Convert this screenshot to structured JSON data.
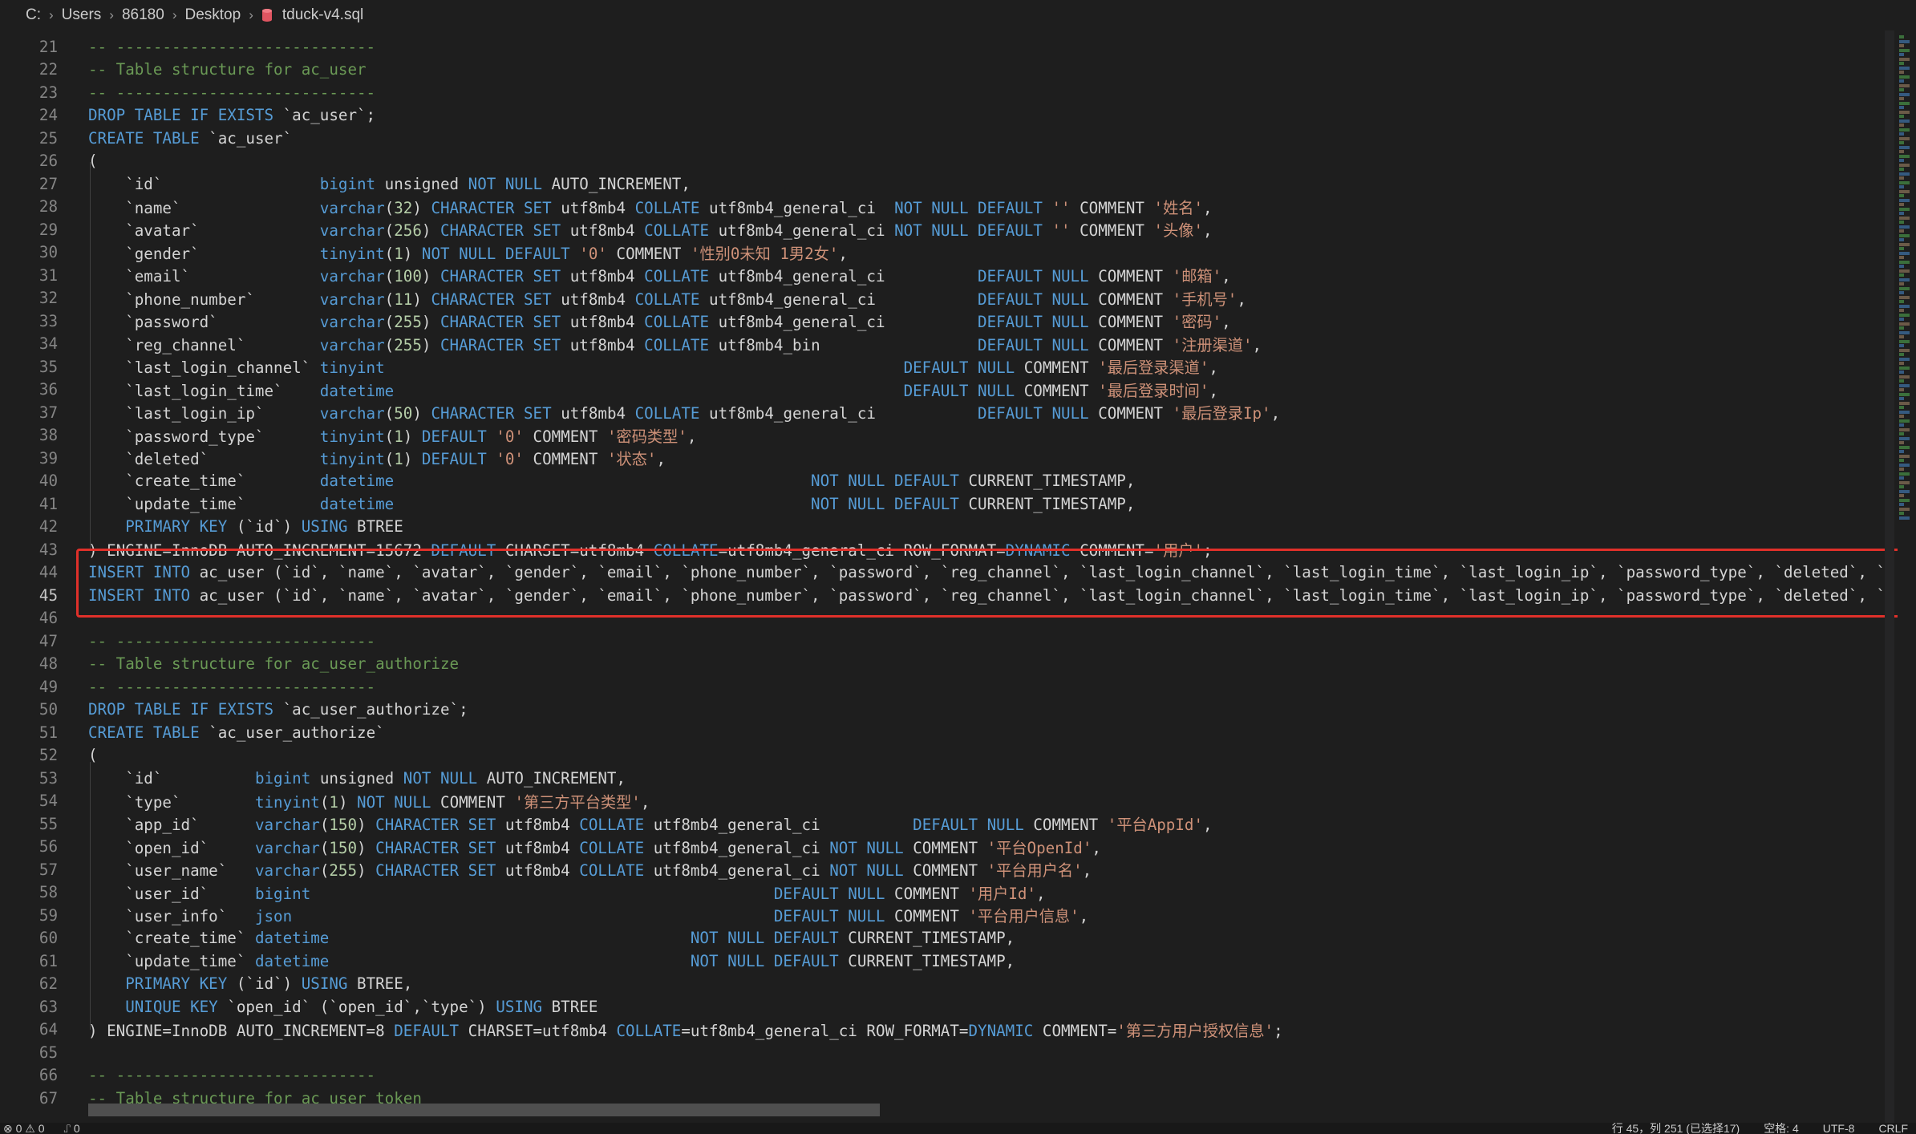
{
  "breadcrumb": {
    "parts": [
      "C:",
      "Users",
      "86180",
      "Desktop",
      "tduck-v4.sql"
    ]
  },
  "status": {
    "problems": "⊗ 0 ⚠ 0",
    "ports": "⑀ 0",
    "position": "行 45，列 251 (已选择17)",
    "spaces": "空格: 4",
    "encoding": "UTF-8",
    "eol": "CRLF"
  },
  "colors": {
    "keyword": "#569cd6",
    "comment": "#6a9955",
    "string": "#ce9178",
    "number": "#b5cea8",
    "highlight": "#e0302a"
  },
  "lines": [
    {
      "n": "21",
      "t": [
        [
          "cm",
          "-- ----------------------------"
        ]
      ]
    },
    {
      "n": "22",
      "t": [
        [
          "cm",
          "-- Table structure for ac_user"
        ]
      ]
    },
    {
      "n": "23",
      "t": [
        [
          "cm",
          "-- ----------------------------"
        ]
      ]
    },
    {
      "n": "24",
      "t": [
        [
          "kw",
          "DROP TABLE IF EXISTS "
        ],
        [
          "tx",
          "`ac_user`;"
        ]
      ]
    },
    {
      "n": "25",
      "t": [
        [
          "kw",
          "CREATE TABLE "
        ],
        [
          "tx",
          "`ac_user`"
        ]
      ]
    },
    {
      "n": "26",
      "t": [
        [
          "tx",
          "("
        ]
      ]
    },
    {
      "n": "27",
      "t": [
        [
          "tx",
          "    `id`                 "
        ],
        [
          "kw",
          "bigint "
        ],
        [
          "tx",
          "unsigned "
        ],
        [
          "kw",
          "NOT NULL "
        ],
        [
          "tx",
          "AUTO_INCREMENT,"
        ]
      ]
    },
    {
      "n": "28",
      "t": [
        [
          "tx",
          "    `name`               "
        ],
        [
          "kw",
          "varchar"
        ],
        [
          "tx",
          "("
        ],
        [
          "nm",
          "32"
        ],
        [
          "tx",
          ") "
        ],
        [
          "kw",
          "CHARACTER SET "
        ],
        [
          "tx",
          "utf8mb4 "
        ],
        [
          "kw",
          "COLLATE "
        ],
        [
          "tx",
          "utf8mb4_general_ci  "
        ],
        [
          "kw",
          "NOT NULL DEFAULT "
        ],
        [
          "st",
          "'' "
        ],
        [
          "tx",
          "COMMENT "
        ],
        [
          "st",
          "'姓名'"
        ],
        [
          "tx",
          ","
        ]
      ]
    },
    {
      "n": "29",
      "t": [
        [
          "tx",
          "    `avatar`             "
        ],
        [
          "kw",
          "varchar"
        ],
        [
          "tx",
          "("
        ],
        [
          "nm",
          "256"
        ],
        [
          "tx",
          ") "
        ],
        [
          "kw",
          "CHARACTER SET "
        ],
        [
          "tx",
          "utf8mb4 "
        ],
        [
          "kw",
          "COLLATE "
        ],
        [
          "tx",
          "utf8mb4_general_ci "
        ],
        [
          "kw",
          "NOT NULL DEFAULT "
        ],
        [
          "st",
          "'' "
        ],
        [
          "tx",
          "COMMENT "
        ],
        [
          "st",
          "'头像'"
        ],
        [
          "tx",
          ","
        ]
      ]
    },
    {
      "n": "30",
      "t": [
        [
          "tx",
          "    `gender`             "
        ],
        [
          "kw",
          "tinyint"
        ],
        [
          "tx",
          "("
        ],
        [
          "nm",
          "1"
        ],
        [
          "tx",
          ") "
        ],
        [
          "kw",
          "NOT NULL DEFAULT "
        ],
        [
          "st",
          "'0' "
        ],
        [
          "tx",
          "COMMENT "
        ],
        [
          "st",
          "'性别0未知 1男2女'"
        ],
        [
          "tx",
          ","
        ]
      ]
    },
    {
      "n": "31",
      "t": [
        [
          "tx",
          "    `email`              "
        ],
        [
          "kw",
          "varchar"
        ],
        [
          "tx",
          "("
        ],
        [
          "nm",
          "100"
        ],
        [
          "tx",
          ") "
        ],
        [
          "kw",
          "CHARACTER SET "
        ],
        [
          "tx",
          "utf8mb4 "
        ],
        [
          "kw",
          "COLLATE "
        ],
        [
          "tx",
          "utf8mb4_general_ci          "
        ],
        [
          "kw",
          "DEFAULT NULL "
        ],
        [
          "tx",
          "COMMENT "
        ],
        [
          "st",
          "'邮箱'"
        ],
        [
          "tx",
          ","
        ]
      ]
    },
    {
      "n": "32",
      "t": [
        [
          "tx",
          "    `phone_number`       "
        ],
        [
          "kw",
          "varchar"
        ],
        [
          "tx",
          "("
        ],
        [
          "nm",
          "11"
        ],
        [
          "tx",
          ") "
        ],
        [
          "kw",
          "CHARACTER SET "
        ],
        [
          "tx",
          "utf8mb4 "
        ],
        [
          "kw",
          "COLLATE "
        ],
        [
          "tx",
          "utf8mb4_general_ci           "
        ],
        [
          "kw",
          "DEFAULT NULL "
        ],
        [
          "tx",
          "COMMENT "
        ],
        [
          "st",
          "'手机号'"
        ],
        [
          "tx",
          ","
        ]
      ]
    },
    {
      "n": "33",
      "t": [
        [
          "tx",
          "    `password`           "
        ],
        [
          "kw",
          "varchar"
        ],
        [
          "tx",
          "("
        ],
        [
          "nm",
          "255"
        ],
        [
          "tx",
          ") "
        ],
        [
          "kw",
          "CHARACTER SET "
        ],
        [
          "tx",
          "utf8mb4 "
        ],
        [
          "kw",
          "COLLATE "
        ],
        [
          "tx",
          "utf8mb4_general_ci          "
        ],
        [
          "kw",
          "DEFAULT NULL "
        ],
        [
          "tx",
          "COMMENT "
        ],
        [
          "st",
          "'密码'"
        ],
        [
          "tx",
          ","
        ]
      ]
    },
    {
      "n": "34",
      "t": [
        [
          "tx",
          "    `reg_channel`        "
        ],
        [
          "kw",
          "varchar"
        ],
        [
          "tx",
          "("
        ],
        [
          "nm",
          "255"
        ],
        [
          "tx",
          ") "
        ],
        [
          "kw",
          "CHARACTER SET "
        ],
        [
          "tx",
          "utf8mb4 "
        ],
        [
          "kw",
          "COLLATE "
        ],
        [
          "tx",
          "utf8mb4_bin                 "
        ],
        [
          "kw",
          "DEFAULT NULL "
        ],
        [
          "tx",
          "COMMENT "
        ],
        [
          "st",
          "'注册渠道'"
        ],
        [
          "tx",
          ","
        ]
      ]
    },
    {
      "n": "35",
      "t": [
        [
          "tx",
          "    `last_login_channel` "
        ],
        [
          "kw",
          "tinyint                                                        DEFAULT NULL "
        ],
        [
          "tx",
          "COMMENT "
        ],
        [
          "st",
          "'最后登录渠道'"
        ],
        [
          "tx",
          ","
        ]
      ]
    },
    {
      "n": "36",
      "t": [
        [
          "tx",
          "    `last_login_time`    "
        ],
        [
          "kw",
          "datetime                                                       DEFAULT NULL "
        ],
        [
          "tx",
          "COMMENT "
        ],
        [
          "st",
          "'最后登录时间'"
        ],
        [
          "tx",
          ","
        ]
      ]
    },
    {
      "n": "37",
      "t": [
        [
          "tx",
          "    `last_login_ip`      "
        ],
        [
          "kw",
          "varchar"
        ],
        [
          "tx",
          "("
        ],
        [
          "nm",
          "50"
        ],
        [
          "tx",
          ") "
        ],
        [
          "kw",
          "CHARACTER SET "
        ],
        [
          "tx",
          "utf8mb4 "
        ],
        [
          "kw",
          "COLLATE "
        ],
        [
          "tx",
          "utf8mb4_general_ci           "
        ],
        [
          "kw",
          "DEFAULT NULL "
        ],
        [
          "tx",
          "COMMENT "
        ],
        [
          "st",
          "'最后登录Ip'"
        ],
        [
          "tx",
          ","
        ]
      ]
    },
    {
      "n": "38",
      "t": [
        [
          "tx",
          "    `password_type`      "
        ],
        [
          "kw",
          "tinyint"
        ],
        [
          "tx",
          "("
        ],
        [
          "nm",
          "1"
        ],
        [
          "tx",
          ") "
        ],
        [
          "kw",
          "DEFAULT "
        ],
        [
          "st",
          "'0' "
        ],
        [
          "tx",
          "COMMENT "
        ],
        [
          "st",
          "'密码类型'"
        ],
        [
          "tx",
          ","
        ]
      ]
    },
    {
      "n": "39",
      "t": [
        [
          "tx",
          "    `deleted`            "
        ],
        [
          "kw",
          "tinyint"
        ],
        [
          "tx",
          "("
        ],
        [
          "nm",
          "1"
        ],
        [
          "tx",
          ") "
        ],
        [
          "kw",
          "DEFAULT "
        ],
        [
          "st",
          "'0' "
        ],
        [
          "tx",
          "COMMENT "
        ],
        [
          "st",
          "'状态'"
        ],
        [
          "tx",
          ","
        ]
      ]
    },
    {
      "n": "40",
      "t": [
        [
          "tx",
          "    `create_time`        "
        ],
        [
          "kw",
          "datetime                                             NOT NULL DEFAULT "
        ],
        [
          "tx",
          "CURRENT_TIMESTAMP,"
        ]
      ]
    },
    {
      "n": "41",
      "t": [
        [
          "tx",
          "    `update_time`        "
        ],
        [
          "kw",
          "datetime                                             NOT NULL DEFAULT "
        ],
        [
          "tx",
          "CURRENT_TIMESTAMP,"
        ]
      ]
    },
    {
      "n": "42",
      "t": [
        [
          "kw",
          "    PRIMARY KEY "
        ],
        [
          "tx",
          "(`id`) "
        ],
        [
          "kw",
          "USING "
        ],
        [
          "tx",
          "BTREE"
        ]
      ]
    },
    {
      "n": "43",
      "strike": true,
      "t": [
        [
          "tx",
          ") ENGINE=InnoDB AUTO_INCREMENT=15672 "
        ],
        [
          "kw",
          "DEFAULT "
        ],
        [
          "tx",
          "CHARSET=utf8mb4 "
        ],
        [
          "kw",
          "COLLATE"
        ],
        [
          "tx",
          "=utf8mb4_general_ci ROW_FORMAT="
        ],
        [
          "kw",
          "DYNAMIC "
        ],
        [
          "tx",
          "COMMENT="
        ],
        [
          "st",
          "'用户'"
        ],
        [
          "tx",
          ";"
        ]
      ]
    },
    {
      "n": "44",
      "t": [
        [
          "kw",
          "INSERT INTO "
        ],
        [
          "tx",
          "ac_user (`id`, `name`, `avatar`, `gender`, `email`, `phone_number`, `password`, `reg_channel`, `last_login_channel`, `last_login_time`, `last_login_ip`, `password_type`, `deleted`, `c"
        ]
      ]
    },
    {
      "n": "45",
      "current": true,
      "t": [
        [
          "kw",
          "INSERT INTO "
        ],
        [
          "tx",
          "ac_user (`id`, `name`, `avatar`, `gender`, `email`, `phone_number`, `password`, `reg_channel`, `last_login_channel`, `last_login_time`, `last_login_ip`, `password_type`, `deleted`, `c"
        ]
      ]
    },
    {
      "n": "46",
      "t": []
    },
    {
      "n": "47",
      "t": [
        [
          "cm",
          "-- ----------------------------"
        ]
      ]
    },
    {
      "n": "48",
      "t": [
        [
          "cm",
          "-- Table structure for ac_user_authorize"
        ]
      ]
    },
    {
      "n": "49",
      "t": [
        [
          "cm",
          "-- ----------------------------"
        ]
      ]
    },
    {
      "n": "50",
      "t": [
        [
          "kw",
          "DROP TABLE IF EXISTS "
        ],
        [
          "tx",
          "`ac_user_authorize`;"
        ]
      ]
    },
    {
      "n": "51",
      "t": [
        [
          "kw",
          "CREATE TABLE "
        ],
        [
          "tx",
          "`ac_user_authorize`"
        ]
      ]
    },
    {
      "n": "52",
      "t": [
        [
          "tx",
          "("
        ]
      ]
    },
    {
      "n": "53",
      "t": [
        [
          "tx",
          "    `id`          "
        ],
        [
          "kw",
          "bigint "
        ],
        [
          "tx",
          "unsigned "
        ],
        [
          "kw",
          "NOT NULL "
        ],
        [
          "tx",
          "AUTO_INCREMENT,"
        ]
      ]
    },
    {
      "n": "54",
      "t": [
        [
          "tx",
          "    `type`        "
        ],
        [
          "kw",
          "tinyint"
        ],
        [
          "tx",
          "("
        ],
        [
          "nm",
          "1"
        ],
        [
          "tx",
          ") "
        ],
        [
          "kw",
          "NOT NULL "
        ],
        [
          "tx",
          "COMMENT "
        ],
        [
          "st",
          "'第三方平台类型'"
        ],
        [
          "tx",
          ","
        ]
      ]
    },
    {
      "n": "55",
      "t": [
        [
          "tx",
          "    `app_id`      "
        ],
        [
          "kw",
          "varchar"
        ],
        [
          "tx",
          "("
        ],
        [
          "nm",
          "150"
        ],
        [
          "tx",
          ") "
        ],
        [
          "kw",
          "CHARACTER SET "
        ],
        [
          "tx",
          "utf8mb4 "
        ],
        [
          "kw",
          "COLLATE "
        ],
        [
          "tx",
          "utf8mb4_general_ci          "
        ],
        [
          "kw",
          "DEFAULT NULL "
        ],
        [
          "tx",
          "COMMENT "
        ],
        [
          "st",
          "'平台AppId'"
        ],
        [
          "tx",
          ","
        ]
      ]
    },
    {
      "n": "56",
      "t": [
        [
          "tx",
          "    `open_id`     "
        ],
        [
          "kw",
          "varchar"
        ],
        [
          "tx",
          "("
        ],
        [
          "nm",
          "150"
        ],
        [
          "tx",
          ") "
        ],
        [
          "kw",
          "CHARACTER SET "
        ],
        [
          "tx",
          "utf8mb4 "
        ],
        [
          "kw",
          "COLLATE "
        ],
        [
          "tx",
          "utf8mb4_general_ci "
        ],
        [
          "kw",
          "NOT NULL "
        ],
        [
          "tx",
          "COMMENT "
        ],
        [
          "st",
          "'平台OpenId'"
        ],
        [
          "tx",
          ","
        ]
      ]
    },
    {
      "n": "57",
      "t": [
        [
          "tx",
          "    `user_name`   "
        ],
        [
          "kw",
          "varchar"
        ],
        [
          "tx",
          "("
        ],
        [
          "nm",
          "255"
        ],
        [
          "tx",
          ") "
        ],
        [
          "kw",
          "CHARACTER SET "
        ],
        [
          "tx",
          "utf8mb4 "
        ],
        [
          "kw",
          "COLLATE "
        ],
        [
          "tx",
          "utf8mb4_general_ci "
        ],
        [
          "kw",
          "NOT NULL "
        ],
        [
          "tx",
          "COMMENT "
        ],
        [
          "st",
          "'平台用户名'"
        ],
        [
          "tx",
          ","
        ]
      ]
    },
    {
      "n": "58",
      "t": [
        [
          "tx",
          "    `user_id`     "
        ],
        [
          "kw",
          "bigint                                                  DEFAULT NULL "
        ],
        [
          "tx",
          "COMMENT "
        ],
        [
          "st",
          "'用户Id'"
        ],
        [
          "tx",
          ","
        ]
      ]
    },
    {
      "n": "59",
      "t": [
        [
          "tx",
          "    `user_info`   "
        ],
        [
          "kw",
          "json                                                    DEFAULT NULL "
        ],
        [
          "tx",
          "COMMENT "
        ],
        [
          "st",
          "'平台用户信息'"
        ],
        [
          "tx",
          ","
        ]
      ]
    },
    {
      "n": "60",
      "t": [
        [
          "tx",
          "    `create_time` "
        ],
        [
          "kw",
          "datetime                                       NOT NULL DEFAULT "
        ],
        [
          "tx",
          "CURRENT_TIMESTAMP,"
        ]
      ]
    },
    {
      "n": "61",
      "t": [
        [
          "tx",
          "    `update_time` "
        ],
        [
          "kw",
          "datetime                                       NOT NULL DEFAULT "
        ],
        [
          "tx",
          "CURRENT_TIMESTAMP,"
        ]
      ]
    },
    {
      "n": "62",
      "t": [
        [
          "kw",
          "    PRIMARY KEY "
        ],
        [
          "tx",
          "(`id`) "
        ],
        [
          "kw",
          "USING "
        ],
        [
          "tx",
          "BTREE,"
        ]
      ]
    },
    {
      "n": "63",
      "t": [
        [
          "kw",
          "    UNIQUE KEY "
        ],
        [
          "tx",
          "`open_id` (`open_id`,`type`) "
        ],
        [
          "kw",
          "USING "
        ],
        [
          "tx",
          "BTREE"
        ]
      ]
    },
    {
      "n": "64",
      "t": [
        [
          "tx",
          ") ENGINE=InnoDB AUTO_INCREMENT=8 "
        ],
        [
          "kw",
          "DEFAULT "
        ],
        [
          "tx",
          "CHARSET=utf8mb4 "
        ],
        [
          "kw",
          "COLLATE"
        ],
        [
          "tx",
          "=utf8mb4_general_ci ROW_FORMAT="
        ],
        [
          "kw",
          "DYNAMIC "
        ],
        [
          "tx",
          "COMMENT="
        ],
        [
          "st",
          "'第三方用户授权信息'"
        ],
        [
          "tx",
          ";"
        ]
      ]
    },
    {
      "n": "65",
      "t": []
    },
    {
      "n": "66",
      "t": [
        [
          "cm",
          "-- ----------------------------"
        ]
      ]
    },
    {
      "n": "67",
      "t": [
        [
          "cm",
          "-- Table structure for ac_user_token"
        ]
      ]
    }
  ]
}
